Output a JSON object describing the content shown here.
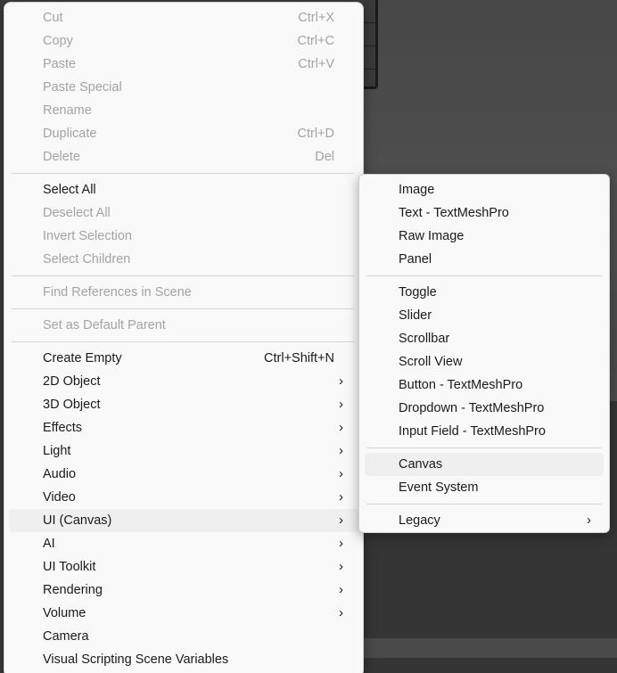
{
  "main_menu": {
    "items": [
      {
        "label": "Cut",
        "shortcut": "Ctrl+X",
        "disabled": true
      },
      {
        "label": "Copy",
        "shortcut": "Ctrl+C",
        "disabled": true
      },
      {
        "label": "Paste",
        "shortcut": "Ctrl+V",
        "disabled": true
      },
      {
        "label": "Paste Special",
        "disabled": true
      },
      {
        "label": "Rename",
        "disabled": true
      },
      {
        "label": "Duplicate",
        "shortcut": "Ctrl+D",
        "disabled": true
      },
      {
        "label": "Delete",
        "shortcut": "Del",
        "disabled": true
      },
      {
        "separator": true
      },
      {
        "label": "Select All",
        "disabled": false
      },
      {
        "label": "Deselect All",
        "disabled": true
      },
      {
        "label": "Invert Selection",
        "disabled": true
      },
      {
        "label": "Select Children",
        "disabled": true
      },
      {
        "separator": true
      },
      {
        "label": "Find References in Scene",
        "disabled": true
      },
      {
        "separator": true
      },
      {
        "label": "Set as Default Parent",
        "disabled": true
      },
      {
        "separator": true
      },
      {
        "label": "Create Empty",
        "shortcut": "Ctrl+Shift+N",
        "disabled": false
      },
      {
        "label": "2D Object",
        "submenu": true
      },
      {
        "label": "3D Object",
        "submenu": true
      },
      {
        "label": "Effects",
        "submenu": true
      },
      {
        "label": "Light",
        "submenu": true
      },
      {
        "label": "Audio",
        "submenu": true
      },
      {
        "label": "Video",
        "submenu": true
      },
      {
        "label": "UI (Canvas)",
        "submenu": true,
        "hover": true
      },
      {
        "label": "AI",
        "submenu": true
      },
      {
        "label": "UI Toolkit",
        "submenu": true
      },
      {
        "label": "Rendering",
        "submenu": true
      },
      {
        "label": "Volume",
        "submenu": true
      },
      {
        "label": "Camera"
      },
      {
        "label": "Visual Scripting Scene Variables"
      }
    ]
  },
  "sub_menu": {
    "items": [
      {
        "label": "Image"
      },
      {
        "label": "Text - TextMeshPro"
      },
      {
        "label": "Raw Image"
      },
      {
        "label": "Panel"
      },
      {
        "separator": true
      },
      {
        "label": "Toggle"
      },
      {
        "label": "Slider"
      },
      {
        "label": "Scrollbar"
      },
      {
        "label": "Scroll View"
      },
      {
        "label": "Button - TextMeshPro"
      },
      {
        "label": "Dropdown - TextMeshPro"
      },
      {
        "label": "Input Field - TextMeshPro"
      },
      {
        "separator": true
      },
      {
        "label": "Canvas",
        "hover": true
      },
      {
        "label": "Event System"
      },
      {
        "separator": true
      },
      {
        "label": "Legacy",
        "submenu": true
      }
    ]
  },
  "icons": {
    "chevron": "›"
  }
}
